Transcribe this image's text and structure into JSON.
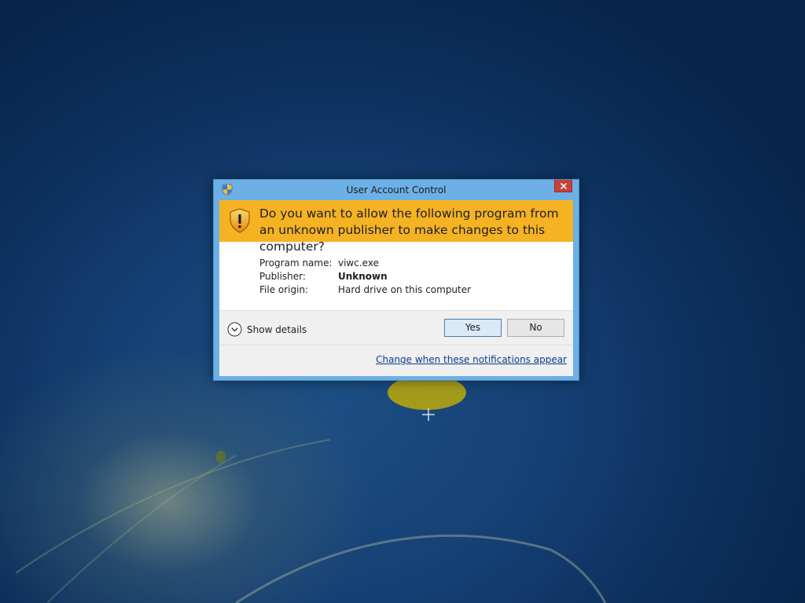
{
  "window": {
    "title": "User Account Control",
    "title_icon": "uac-shield-icon",
    "close_icon": "close-icon"
  },
  "banner": {
    "question": "Do you want to allow the following program from an unknown publisher to make changes to this computer?",
    "icon": "warning-shield-icon",
    "color": "#f5b323"
  },
  "details": {
    "program_name_label": "Program name:",
    "program_name_value": "viwc.exe",
    "publisher_label": "Publisher:",
    "publisher_value": "Unknown",
    "file_origin_label": "File origin:",
    "file_origin_value": "Hard drive on this computer"
  },
  "actions": {
    "show_details_label": "Show details",
    "show_details_icon": "chevron-down-icon",
    "yes_label": "Yes",
    "no_label": "No",
    "change_link": "Change when these notifications appear"
  },
  "colors": {
    "window_frame": "#6cb0e6",
    "close_button": "#c7403a",
    "link": "#0b3c8c"
  }
}
